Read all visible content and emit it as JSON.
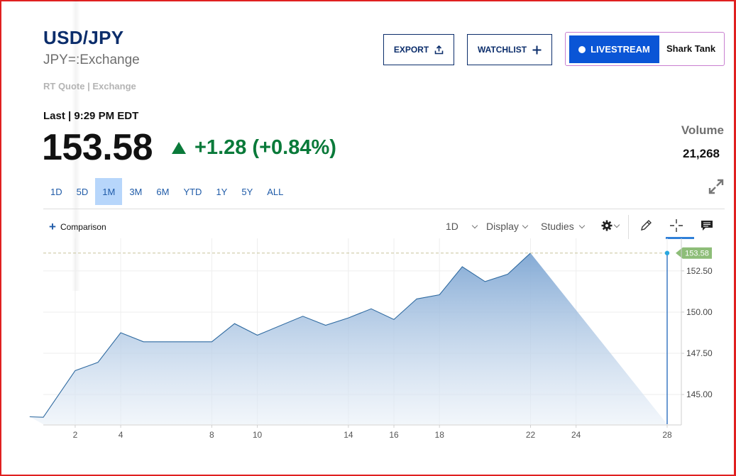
{
  "header": {
    "symbol": "USD/JPY",
    "exchange": "JPY=:Exchange",
    "quote_type": "RT Quote | Exchange",
    "last_time": "Last | 9:29 PM EDT",
    "price": "153.58",
    "change": "+1.28 (+0.84%)",
    "volume_label": "Volume",
    "volume_value": "21,268"
  },
  "actions": {
    "export_label": "EXPORT",
    "watchlist_label": "WATCHLIST",
    "livestream_label": "LIVESTREAM",
    "show_name": "Shark Tank"
  },
  "ranges": [
    "1D",
    "5D",
    "1M",
    "3M",
    "6M",
    "YTD",
    "1Y",
    "5Y",
    "ALL"
  ],
  "active_range": "1M",
  "toolbar": {
    "comparison_label": "Comparison",
    "interval_label": "1D",
    "display_label": "Display",
    "studies_label": "Studies"
  },
  "icons": [
    "upload-icon",
    "plus-icon",
    "expand-icon",
    "gear-icon",
    "pencil-icon",
    "crosshair-icon",
    "comment-icon"
  ],
  "colors": {
    "brand": "#0b2d6b",
    "up": "#0a7a3a",
    "line": "#2f6aa0",
    "price_tag": "#8dbd78",
    "active_range_bg": "#b7d6fb",
    "livestream_bg": "#0a55d6"
  },
  "chart_data": {
    "type": "area",
    "x": [
      0,
      1,
      2,
      3,
      4,
      5,
      6,
      7,
      8,
      9,
      10,
      11,
      12,
      13,
      14,
      15,
      16,
      17,
      18,
      19,
      20,
      21,
      22,
      23,
      24,
      25,
      26,
      27,
      28
    ],
    "series": [
      {
        "values": [
          143.65,
          143.62,
          146.45,
          146.95,
          148.75,
          148.45,
          148.2,
          148.2,
          148.75,
          149.3,
          148.95,
          148.6,
          148.95,
          149.35,
          149.75,
          149.45,
          149.2,
          149.4,
          149.65,
          149.95,
          150.2,
          149.85,
          149.55,
          150.15,
          150.8,
          150.95,
          151.05,
          151.9,
          152.75,
          152.25,
          151.85,
          152.05,
          152.3,
          152.95,
          153.58
        ]
      }
    ],
    "points": [
      [
        0.0,
        143.65
      ],
      [
        0.6,
        143.62
      ],
      [
        2,
        146.45
      ],
      [
        3.0,
        146.95
      ],
      [
        4,
        148.75
      ],
      [
        5.0,
        148.2
      ],
      [
        6.0,
        148.2
      ],
      [
        7.0,
        148.2
      ],
      [
        8,
        148.2
      ],
      [
        9.0,
        149.3
      ],
      [
        10,
        148.6
      ],
      [
        12,
        149.75
      ],
      [
        13,
        149.2
      ],
      [
        14,
        149.65
      ],
      [
        15,
        150.2
      ],
      [
        16,
        149.55
      ],
      [
        17,
        150.8
      ],
      [
        18,
        151.05
      ],
      [
        19,
        152.75
      ],
      [
        20,
        151.85
      ],
      [
        21,
        152.3
      ],
      [
        22,
        153.58
      ]
    ],
    "xticks": [
      "2",
      "4",
      "8",
      "10",
      "14",
      "16",
      "18",
      "22",
      "24",
      "28"
    ],
    "xtick_values": [
      2,
      4,
      8,
      10,
      14,
      16,
      18,
      22,
      24,
      28
    ],
    "yticks": [
      "145.00",
      "147.50",
      "150.00",
      "152.50"
    ],
    "ytick_values": [
      145,
      147.5,
      150,
      152.5
    ],
    "last_value_label": "153.58",
    "xlim": [
      0.6,
      28
    ],
    "ylim": [
      143.2,
      154.3
    ],
    "grid": true
  }
}
